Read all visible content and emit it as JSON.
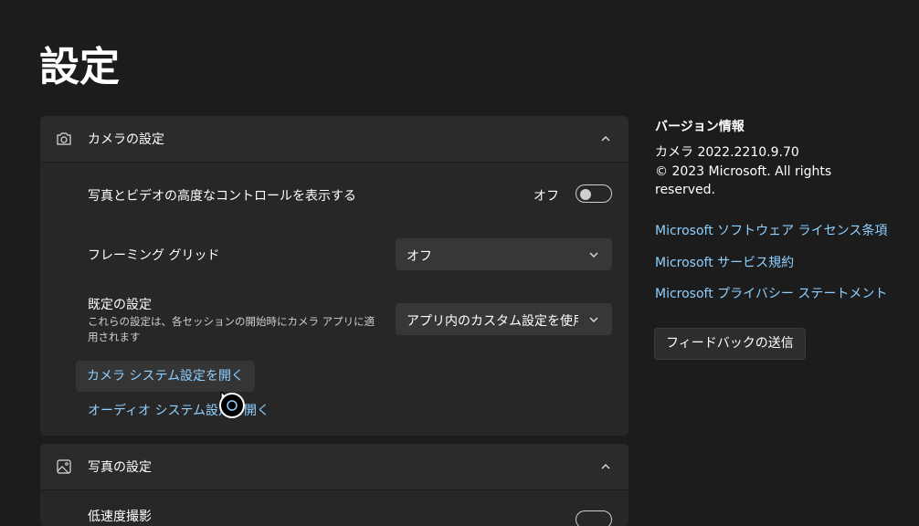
{
  "page": {
    "title": "設定"
  },
  "camera_section": {
    "title": "カメラの設定",
    "advanced_controls": {
      "label": "写真とビデオの高度なコントロールを表示する",
      "state_text": "オフ",
      "on": false
    },
    "framing_grid": {
      "label": "フレーミング グリッド",
      "selected": "オフ"
    },
    "default_settings": {
      "label": "既定の設定",
      "description": "これらの設定は、各セッションの開始時にカメラ アプリに適用されます",
      "selected": "アプリ内のカスタム設定を使用する"
    },
    "open_camera_system_settings": "カメラ システム設定を開く",
    "open_audio_system_settings": "オーディオ システム設定を開く"
  },
  "photo_section": {
    "title": "写真の設定",
    "first_row_label": "低速度撮影"
  },
  "about": {
    "title": "バージョン情報",
    "version": "カメラ  2022.2210.9.70",
    "copyright": "© 2023 Microsoft. All rights reserved.",
    "links": [
      "Microsoft ソフトウェア ライセンス条項",
      "Microsoft サービス規約",
      "Microsoft プライバシー ステートメント"
    ],
    "feedback_button": "フィードバックの送信"
  },
  "colors": {
    "background": "#1c1c1c",
    "card": "#2b2b2b",
    "link": "#8fd0ff"
  }
}
